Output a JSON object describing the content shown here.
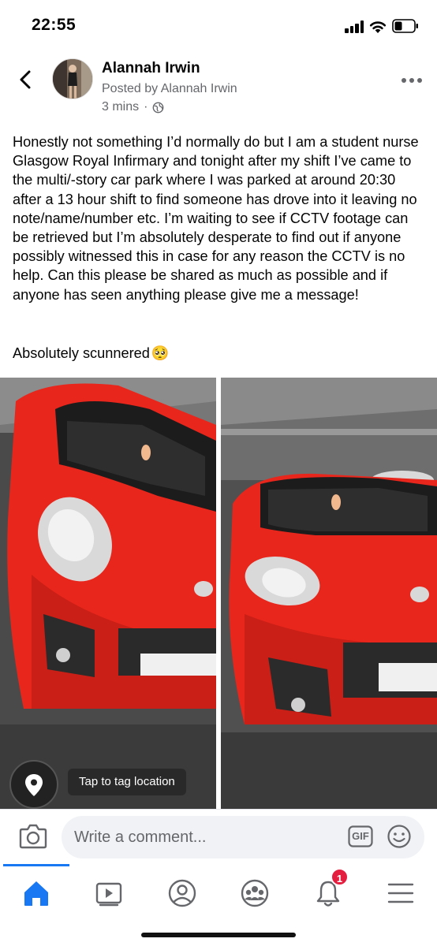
{
  "status_bar": {
    "time": "22:55"
  },
  "post": {
    "author": "Alannah Irwin",
    "posted_by": "Posted by Alannah Irwin",
    "time_ago": "3 mins",
    "separator": "·",
    "audience_icon": "globe-icon",
    "body": "Honestly not something I’d normally do but I am a student nurse Glasgow Royal Infirmary and tonight after my shift I’ve came to the multi/-story car park where I was parked at around 20:30 after a 13 hour shift to find someone has drove into it leaving no note/name/number etc. I’m waiting to see if CCTV footage can be retrieved but I’m absolutely desperate to find out if anyone possibly witnessed this in case for any reason the CCTV is no help. Can this please be shared as much as possible and if anyone has seen anything please give me a message!",
    "closing": "Absolutely scunnered",
    "closing_emoji": "🥺"
  },
  "location": {
    "tooltip": "Tap to tag location"
  },
  "comment_bar": {
    "placeholder": "Write a comment...",
    "gif_label": "GIF"
  },
  "tabs": [
    {
      "name": "home",
      "icon": "home-icon",
      "active": true
    },
    {
      "name": "watch",
      "icon": "video-icon",
      "active": false
    },
    {
      "name": "profile",
      "icon": "profile-icon",
      "active": false
    },
    {
      "name": "groups",
      "icon": "groups-icon",
      "active": false
    },
    {
      "name": "notifications",
      "icon": "bell-icon",
      "active": false,
      "badge": "1"
    },
    {
      "name": "menu",
      "icon": "menu-icon",
      "active": false
    }
  ],
  "colors": {
    "accent": "#1877f2",
    "badge": "#e41e3f",
    "car": "#e8261c"
  }
}
